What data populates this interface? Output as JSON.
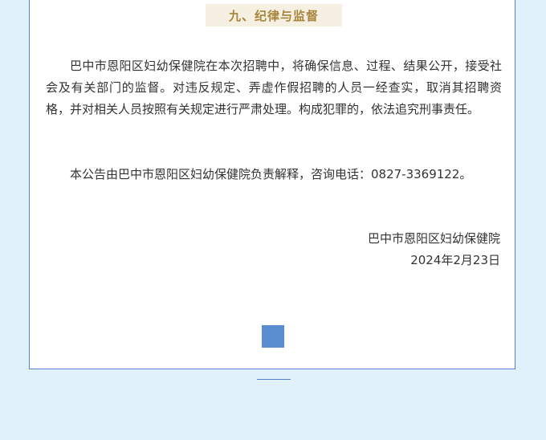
{
  "section": {
    "title": "九、纪律与监督"
  },
  "content": {
    "paragraph_1": "巴中市恩阳区妇幼保健院在本次招聘中，将确保信息、过程、结果公开，接受社会及有关部门的监督。对违反规定、弄虚作假招聘的人员一经查实，取消其招聘资格，并对相关人员按照有关规定进行严肃处理。构成犯罪的，依法追究刑事责任。",
    "paragraph_2": "本公告由巴中市恩阳区妇幼保健院负责解释，咨询电话：0827-3369122。"
  },
  "signature": {
    "organization": "巴中市恩阳区妇幼保健院",
    "date": "2024年2月23日"
  },
  "colors": {
    "page_background": "#e0f1fc",
    "card_border": "#5b7fd0",
    "title_background": "#f6f0e2",
    "title_text": "#a8843c",
    "end_marker": "#5a8ed0"
  }
}
